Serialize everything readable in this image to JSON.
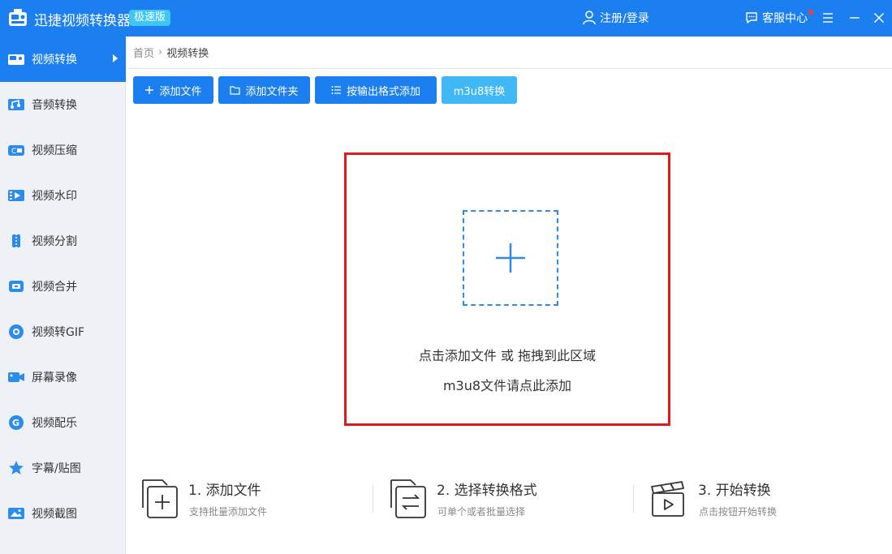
{
  "app": {
    "title": "迅捷视频转换器",
    "edition": "极速版",
    "login_label": "注册/登录",
    "service_label": "客服中心"
  },
  "sidebar": {
    "items": [
      {
        "label": "视频转换",
        "icon": "video-convert-icon",
        "active": true
      },
      {
        "label": "音频转换",
        "icon": "audio-convert-icon"
      },
      {
        "label": "视频压缩",
        "icon": "video-compress-icon"
      },
      {
        "label": "视频水印",
        "icon": "video-watermark-icon"
      },
      {
        "label": "视频分割",
        "icon": "video-split-icon"
      },
      {
        "label": "视频合并",
        "icon": "video-merge-icon"
      },
      {
        "label": "视频转GIF",
        "icon": "video-gif-icon"
      },
      {
        "label": "屏幕录像",
        "icon": "screen-record-icon"
      },
      {
        "label": "视频配乐",
        "icon": "video-music-icon"
      },
      {
        "label": "字幕/贴图",
        "icon": "subtitle-sticker-icon"
      },
      {
        "label": "视频截图",
        "icon": "video-screenshot-icon"
      }
    ]
  },
  "breadcrumb": {
    "home": "首页",
    "current": "视频转换"
  },
  "toolbar": {
    "add_file": "添加文件",
    "add_folder": "添加文件夹",
    "add_by_format": "按输出格式添加",
    "m3u8": "m3u8转换"
  },
  "dropzone": {
    "line1": "点击添加文件 或 拖拽到此区域",
    "line2": "m3u8文件请点此添加"
  },
  "steps": [
    {
      "title": "1. 添加文件",
      "desc": "支持批量添加文件"
    },
    {
      "title": "2. 选择转换格式",
      "desc": "可单个或者批量选择"
    },
    {
      "title": "3. 开始转换",
      "desc": "点击按钮开始转换"
    }
  ],
  "colors": {
    "primary": "#1b7ff0",
    "light_button": "#3fb8f5",
    "dropzone_border": "#e0191c",
    "sidebar_bg": "#eef2f7"
  }
}
